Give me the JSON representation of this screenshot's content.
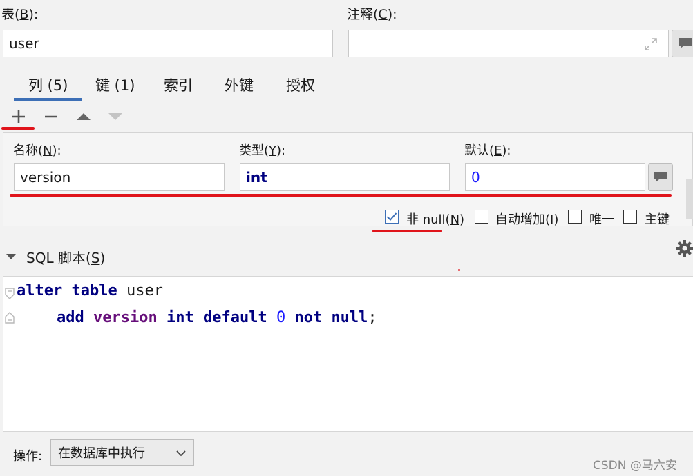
{
  "table": {
    "label_prefix": "表(",
    "label_key": "B",
    "label_suffix": "):",
    "value": "user"
  },
  "comment": {
    "label_prefix": "注释(",
    "label_key": "C",
    "label_suffix": "):",
    "value": ""
  },
  "tabs": [
    {
      "label": "列 (5)",
      "active": true
    },
    {
      "label": "键 (1)",
      "active": false
    },
    {
      "label": "索引",
      "active": false
    },
    {
      "label": "外键",
      "active": false
    },
    {
      "label": "授权",
      "active": false
    }
  ],
  "toolbar": {
    "add": "+",
    "remove": "−"
  },
  "column": {
    "name_label_prefix": "名称(",
    "name_label_key": "N",
    "name_label_suffix": "):",
    "name_value": "version",
    "type_label_prefix": "类型(",
    "type_label_key": "Y",
    "type_label_suffix": "):",
    "type_value": "int",
    "default_label_prefix": "默认(",
    "default_label_key": "E",
    "default_label_suffix": "):",
    "default_value": "0"
  },
  "options": {
    "not_null": {
      "prefix": "非 null(",
      "key": "N",
      "suffix": ")",
      "checked": true
    },
    "auto_increment": {
      "label": "自动增加(I)",
      "checked": false
    },
    "unique": {
      "label": "唯一",
      "checked": false
    },
    "primary_key": {
      "label": "主键",
      "checked": false
    }
  },
  "sql": {
    "title_prefix": "SQL 脚本(",
    "title_key": "S",
    "title_suffix": ")",
    "line1": {
      "kw1": "alter",
      "kw2": "table",
      "ident": "user"
    },
    "line2": {
      "kw1": "add",
      "ident": "version",
      "type": "int",
      "kw2": "default",
      "num": "0",
      "kw3": "not",
      "kw4": "null",
      "end": ";"
    }
  },
  "action": {
    "label": "操作:",
    "selected": "在数据库中执行"
  },
  "watermark": "CSDN @马六安",
  "colors": {
    "accent": "#3d6fb6",
    "annotation": "#e0141b",
    "keyword": "#000080",
    "identifier_purple": "#660e7a",
    "number": "#1a1aff"
  }
}
